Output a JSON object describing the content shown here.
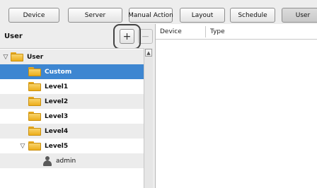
{
  "toolbar": {
    "buttons": [
      {
        "label": "Device"
      },
      {
        "label": "Server"
      },
      {
        "label": "Manual Action"
      },
      {
        "label": "Layout"
      },
      {
        "label": "Schedule"
      },
      {
        "label": "User",
        "active": true
      }
    ]
  },
  "left_panel": {
    "title": "User",
    "add_label": "+",
    "remove_label": "−"
  },
  "tree": {
    "items": [
      {
        "label": "User",
        "icon": "folder-icon",
        "expanded": true
      },
      {
        "label": "Custom",
        "icon": "folder-icon",
        "selected": true
      },
      {
        "label": "Level1",
        "icon": "folder-icon"
      },
      {
        "label": "Level2",
        "icon": "folder-icon"
      },
      {
        "label": "Level3",
        "icon": "folder-icon"
      },
      {
        "label": "Level4",
        "icon": "folder-icon"
      },
      {
        "label": "Level5",
        "icon": "folder-icon",
        "expanded": true
      },
      {
        "label": "admin",
        "icon": "user-icon"
      }
    ]
  },
  "table": {
    "columns": [
      "Device",
      "Type"
    ]
  },
  "colors": {
    "selection": "#3d86d1",
    "folder": "#ecae1c",
    "panel_bg": "#ededed"
  }
}
